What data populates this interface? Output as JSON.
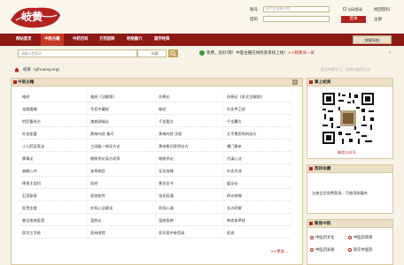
{
  "header": {
    "logo_alt": "岐黄",
    "login": {
      "account_label": "账号",
      "account_placeholder": "用户名/邮箱/手机",
      "password_label": "密码",
      "auto_login_label": "自动登录",
      "login_button": "登录",
      "register_link": "注册",
      "forgot_link": "找回密码"
    }
  },
  "nav": {
    "items": [
      "网站首页",
      "中医古籍",
      "中药百科",
      "方剂选粹",
      "经络腧穴",
      "国学经典"
    ],
    "quick_nav": "快捷导航"
  },
  "search": {
    "placeholder": "请输入检索词",
    "select_value": "标题"
  },
  "welcome": {
    "text": "免费，您好!两！中医古籍在线检索系统上线！",
    "link": ">>我要试一试"
  },
  "breadcrumb": {
    "text": "岐黄（qihuang.org）",
    "right": "您共中医学习，弘扬中医药文化"
  },
  "left_panel": {
    "title": "中医古籍",
    "cells": [
      [
        "难经",
        "难经《注解版》",
        "伤寒论",
        "伤寒论《条文注解版》"
      ],
      [
        "金匮要略",
        "华氏中藏经",
        "脉经",
        "针灸甲乙经"
      ],
      [
        "肘后备急方",
        "诸病源候论",
        "千金要方",
        "千金翼方"
      ],
      [
        "外台秘要",
        "黄帝内经 素问",
        "黄帝内经 灵枢",
        "太平惠民和剂局方"
      ],
      [
        "小儿药证直诀",
        "三因极一病证方论",
        "黄帝素问宣明论方",
        "儒门事亲"
      ],
      [
        "脾胃论",
        "格致余论局方发挥",
        "格致余论",
        "丹溪心法"
      ],
      [
        "扁鹊心书",
        "本草纲目",
        "证治准绳",
        "针灸大成"
      ],
      [
        "傅青主女科",
        "医经",
        "景岳全书",
        "瘟证论"
      ],
      [
        "石室秘录",
        "医效秘传",
        "张氏医通",
        "四诊抉微"
      ],
      [
        "医贯金鉴",
        "外科心法要诀",
        "四圣心源",
        "长沙药解"
      ],
      [
        "临证指南医案",
        "温热论",
        "温病条辨",
        "神农本草经"
      ],
      [
        "医学三字经",
        "医林改错",
        "医学衷中参西录",
        "医说"
      ]
    ],
    "more": ">>更多..."
  },
  "right": {
    "qr_title": "掌上岐黄",
    "qr_caption": "微信公众号",
    "fav_title": "我的收藏",
    "fav_text_pre": "注册会员免费登录，可使用收藏夹",
    "rec_title": "聚焦中医",
    "rec_items": [
      "中医药文化",
      "中医药政策",
      "中医药发展",
      "知识中医院"
    ]
  }
}
